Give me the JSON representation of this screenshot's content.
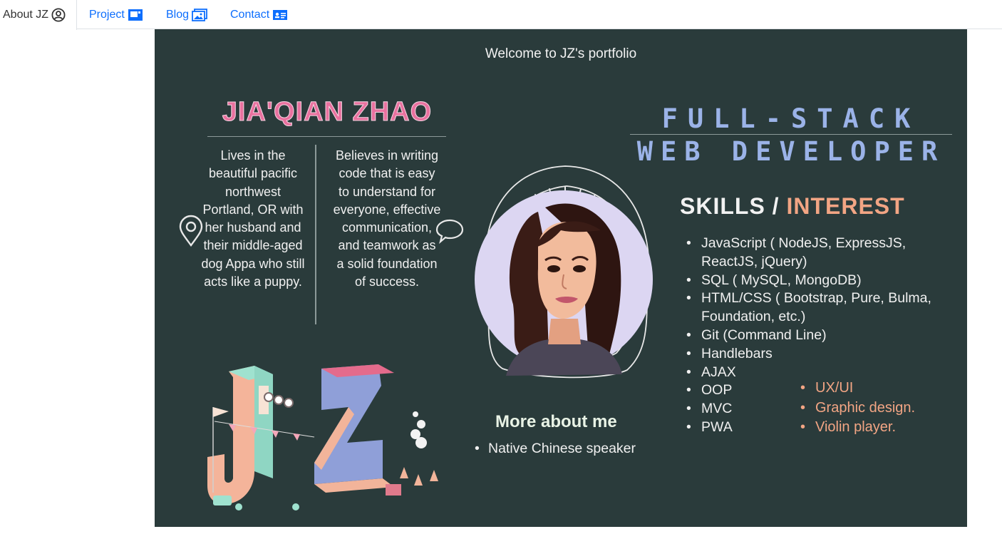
{
  "nav": {
    "tabs": [
      {
        "label": "About JZ",
        "icon": "person-circle-icon",
        "active": true
      },
      {
        "label": "Project",
        "icon": "project-icon",
        "active": false
      },
      {
        "label": "Blog",
        "icon": "images-icon",
        "active": false
      },
      {
        "label": "Contact",
        "icon": "contact-card-icon",
        "active": false
      }
    ]
  },
  "banner": {
    "welcome": "Welcome to JZ's portfolio",
    "name": "JIA'QIAN ZHAO",
    "bio_left": "Lives in the beautiful pacific northwest Portland, OR with her husband and their middle-aged dog Appa who still acts like a puppy.",
    "bio_right": "Believes in writing code that is easy to understand for everyone, effective communication, and teamwork as a solid foundation of success.",
    "title_line1": "FULL-STACK",
    "title_line2": "WEB DEVELOPER",
    "skills_heading": "SKILLS",
    "skills_sep": " / ",
    "interest_heading": "INTEREST",
    "skills": [
      "JavaScript ( NodeJS, ExpressJS, ReactJS, jQuery)",
      "SQL ( MySQL, MongoDB)",
      "HTML/CSS ( Bootstrap, Pure, Bulma, Foundation, etc.)",
      "Git (Command Line)",
      "Handlebars",
      "AJAX",
      "OOP",
      "MVC",
      "PWA"
    ],
    "interests": [
      "UX/UI",
      "Graphic design.",
      "Violin player."
    ],
    "more_title": "More about me",
    "more_items": [
      "Native Chinese speaker"
    ]
  },
  "colors": {
    "link": "#0d6efd",
    "banner_bg": "#2a3b3b",
    "name_pink": "#e9719f",
    "title_blue": "#9bb3e8",
    "interest_orange": "#f2a584"
  }
}
